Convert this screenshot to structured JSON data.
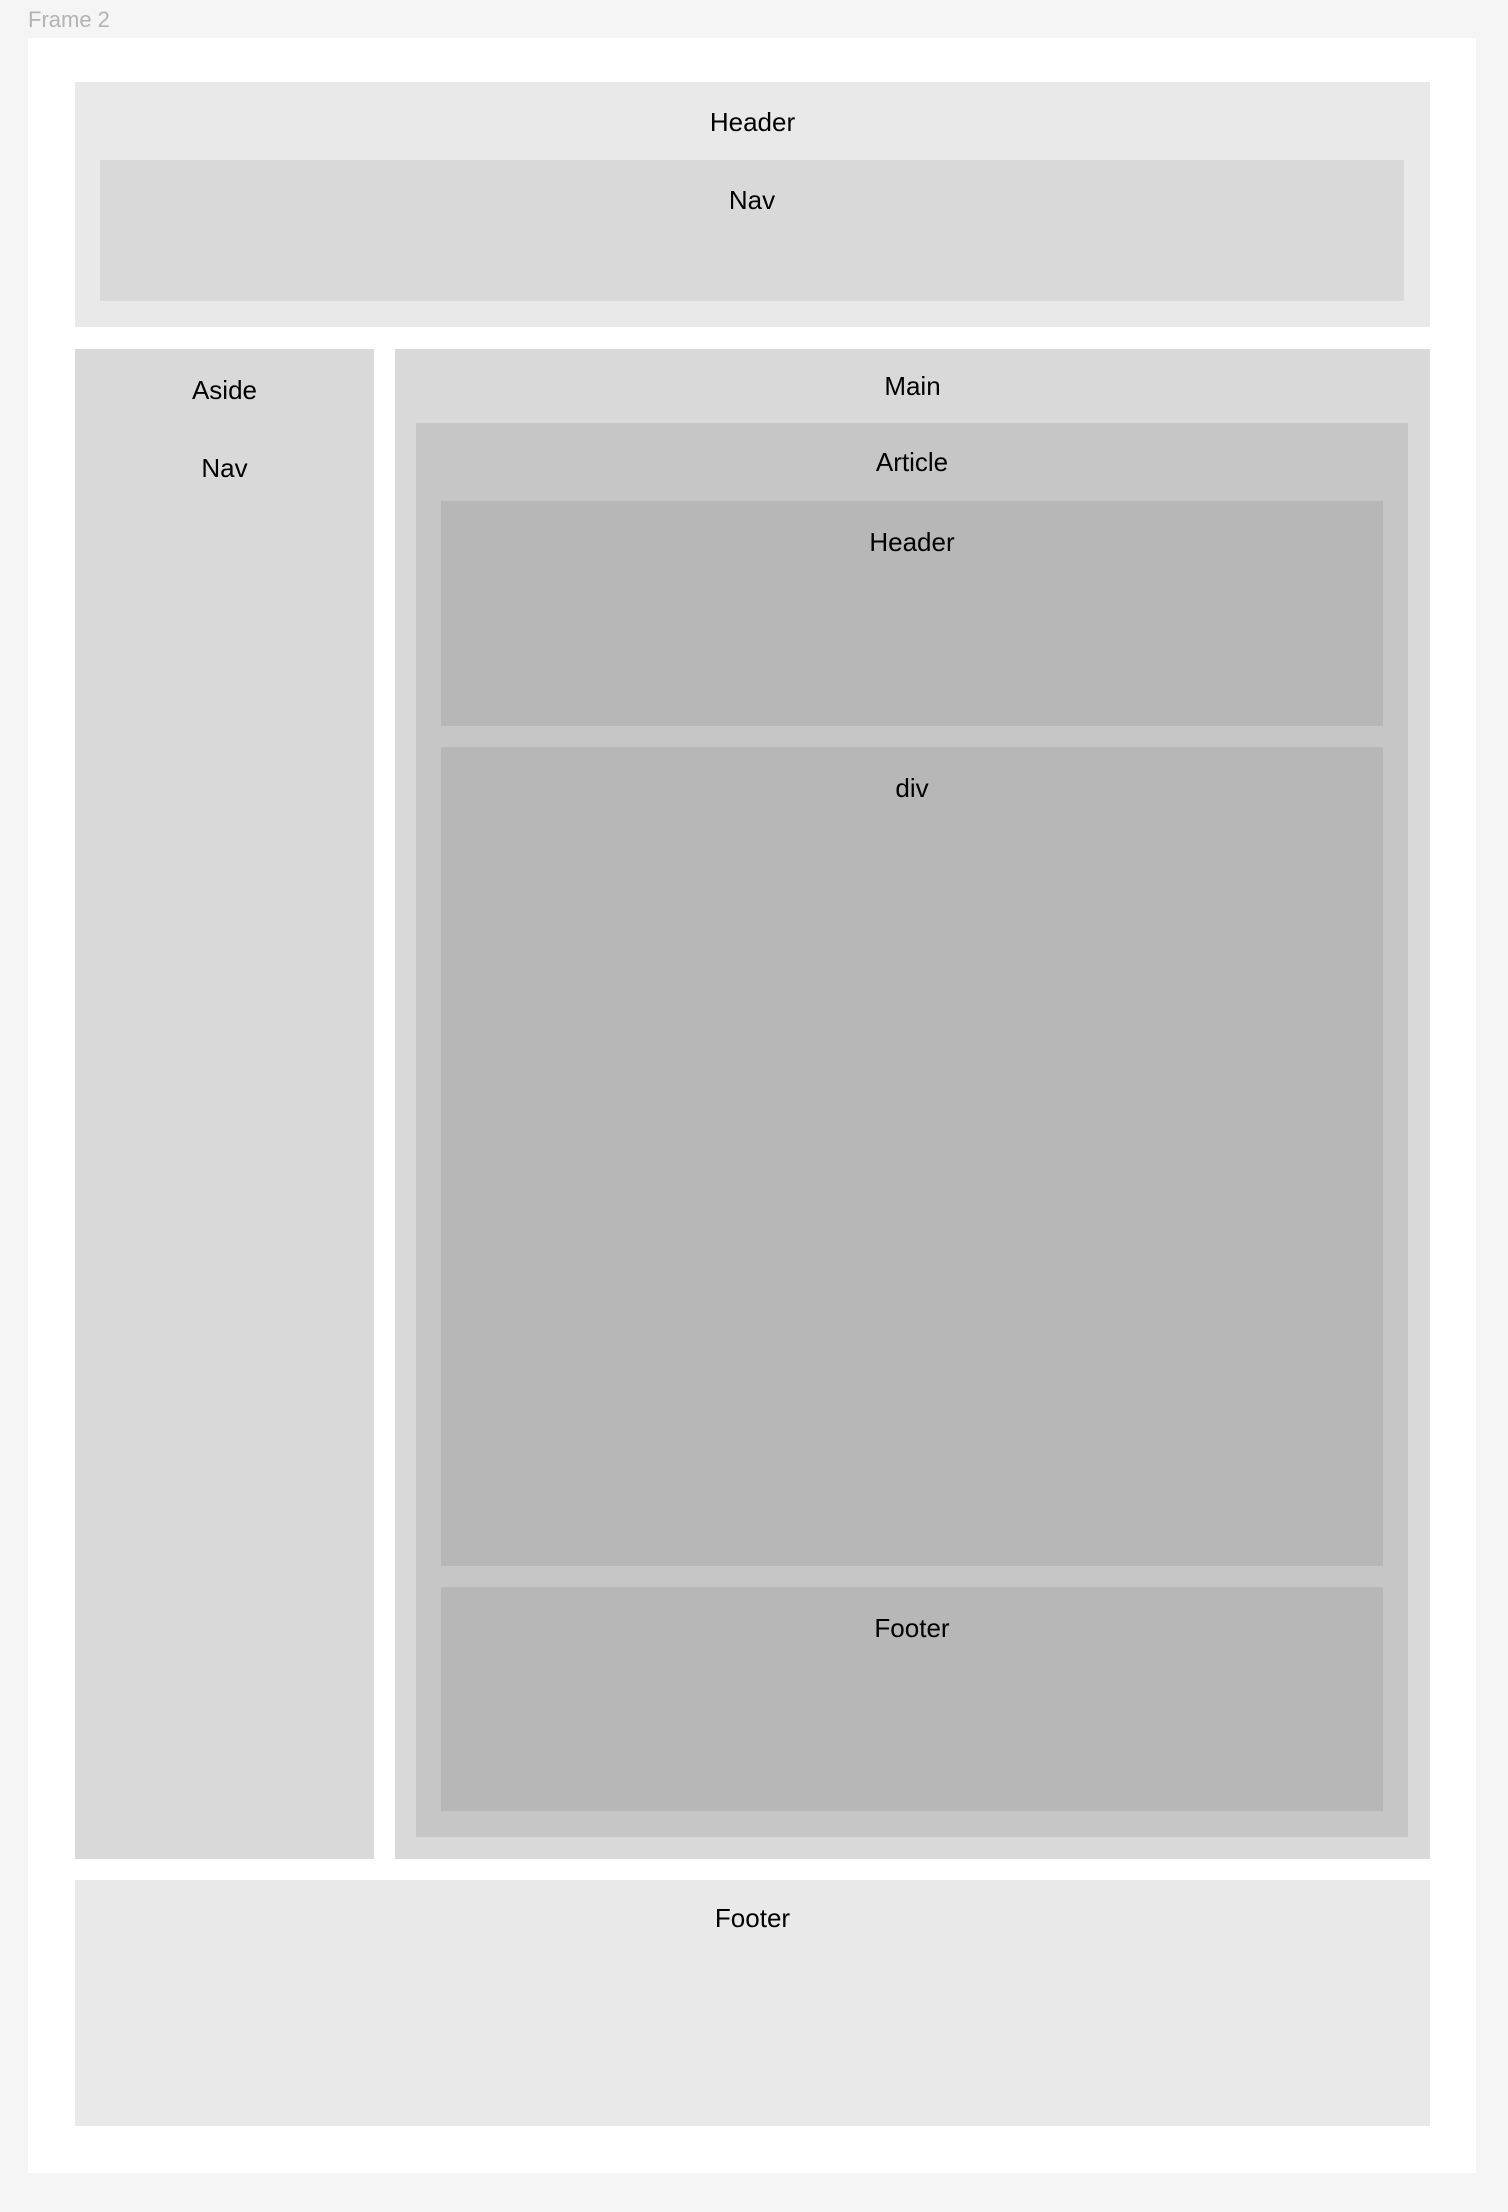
{
  "frame": {
    "label": "Frame 2"
  },
  "header": {
    "label": "Header",
    "nav": {
      "label": "Nav"
    }
  },
  "aside": {
    "label": "Aside",
    "nav_label": "Nav"
  },
  "main": {
    "label": "Main",
    "article": {
      "label": "Article",
      "header_label": "Header",
      "div_label": "div",
      "footer_label": "Footer"
    }
  },
  "footer": {
    "label": "Footer"
  },
  "colors": {
    "canvas": "#f5f5f5",
    "frame": "#ffffff",
    "header_footer": "#e9e9e9",
    "nav_aside_main": "#d9d9d9",
    "article": "#c6c6c6",
    "article_children": "#b7b7b7"
  }
}
